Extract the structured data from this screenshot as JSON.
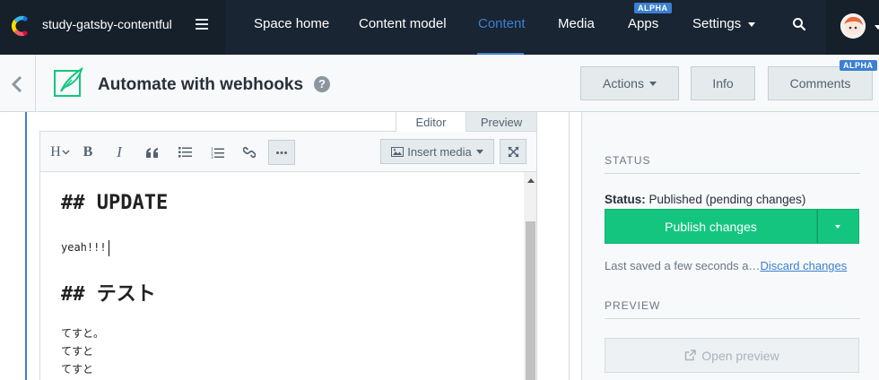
{
  "topnav": {
    "space_name": "study-gatsby-contentful",
    "items": [
      {
        "label": "Space home"
      },
      {
        "label": "Content model"
      },
      {
        "label": "Content",
        "active": true
      },
      {
        "label": "Media"
      },
      {
        "label": "Apps",
        "badge": "ALPHA"
      },
      {
        "label": "Settings"
      }
    ]
  },
  "header": {
    "title": "Automate with webhooks",
    "help": "?",
    "actions_label": "Actions",
    "info_label": "Info",
    "comments_label": "Comments",
    "comments_badge": "ALPHA"
  },
  "editor": {
    "tabs": [
      {
        "label": "Editor",
        "active": true
      },
      {
        "label": "Preview"
      }
    ],
    "toolbar": {
      "heading": "H",
      "bold": "B",
      "italic": "I",
      "insert_media": "Insert media"
    },
    "content": {
      "line1": "## UPDATE",
      "line2": "yeah!!!",
      "line3": "## テスト",
      "line4": "てすと。",
      "line5": "てすと",
      "line6": "てすと"
    }
  },
  "sidebar": {
    "status_heading": "STATUS",
    "status_label": "Status:",
    "status_value": "Published (pending changes)",
    "publish_label": "Publish changes",
    "saved_text": "Last saved a few seconds a…",
    "discard_label": "Discard changes",
    "preview_heading": "PREVIEW",
    "open_preview_label": "Open preview"
  },
  "colors": {
    "nav_bg": "#192532",
    "accent": "#3c80cf",
    "publish_green": "#14c57f"
  }
}
